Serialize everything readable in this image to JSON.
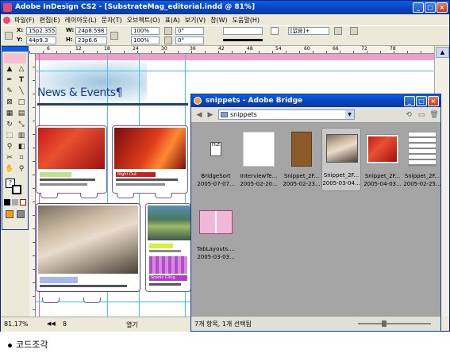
{
  "app": {
    "title": "Adobe InDesign CS2 - [SubstrateMag_editorial.indd @ 81%]"
  },
  "menu": [
    "파일(F)",
    "편집(E)",
    "레이아웃(L)",
    "문자(T)",
    "오브젝트(O)",
    "표(A)",
    "보기(V)",
    "창(W)",
    "도움말(H)"
  ],
  "control": {
    "x_label": "X:",
    "x_value": "15p2.355",
    "y_label": "Y:",
    "y_value": "44p9.3",
    "w_label": "W:",
    "w_value": "24p8.598",
    "h_label": "H:",
    "h_value": "23p6.6",
    "scale_x": "100%",
    "scale_y": "100%",
    "rotate": "0°",
    "shear": "0°",
    "stroke_weight": "",
    "style": "[없음]+"
  },
  "ruler": {
    "ticks": [
      "6",
      "12",
      "18",
      "24",
      "30",
      "36",
      "42",
      "48",
      "54",
      "60",
      "66",
      "72",
      "78"
    ]
  },
  "document": {
    "heading": "News & Events¶",
    "red_label_1": "Night Out",
    "purple_label": "Scenic Cling"
  },
  "statusbar": {
    "zoom": "81.17%",
    "page": "8",
    "open_label": "열기"
  },
  "bridge": {
    "title": "snippets - Adobe Bridge",
    "path": "snippets",
    "status": "7개 항목, 1개 선택됨",
    "items": [
      {
        "name": "BridgeSort",
        "date": "2005-07-07...",
        "selected": false
      },
      {
        "name": "InterviewTe...",
        "date": "2005-02-20...",
        "selected": false
      },
      {
        "name": "Snippet_2F...",
        "date": "2005-02-23...",
        "selected": false
      },
      {
        "name": "Snippet_2F...",
        "date": "2005-03-04...",
        "selected": true
      },
      {
        "name": "Snippet_2F...",
        "date": "2005-04-03...",
        "selected": false
      },
      {
        "name": "Snippet_2F...",
        "date": "2005-02-25...",
        "selected": false
      },
      {
        "name": "TabLayouts....",
        "date": "2005-03-03...",
        "selected": false
      }
    ]
  },
  "caption": "코드조각"
}
